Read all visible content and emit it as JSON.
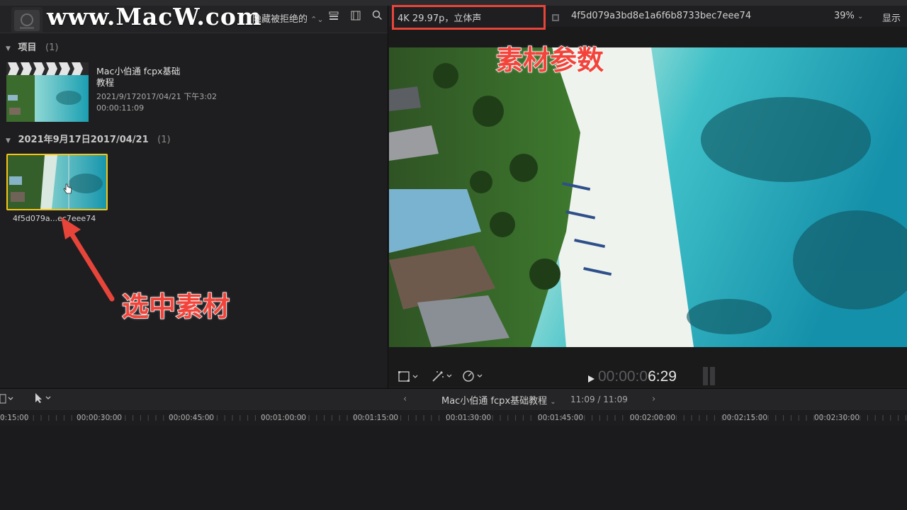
{
  "watermark": "www.MacW.com",
  "browser_bar": {
    "filter_label": "隐藏被拒绝的",
    "clip_info": "4K 29.97p，立体声",
    "clip_name": "4f5d079a3bd8e1a6f6b8733bec7eee74",
    "zoom": "39%",
    "display_label": "显示"
  },
  "library": {
    "projects_header": "项目",
    "projects_count": "(1)",
    "project": {
      "title_line1": "Mac小伯通 fcpx基础",
      "title_line2": "教程",
      "date": "2021/9/172017/04/21 下午3:02",
      "duration": "00:00:11:09"
    },
    "event_header": "2021年9月17日2017/04/21",
    "event_count": "(1)",
    "clip_label": "4f5d079a...ec7eee74"
  },
  "viewer": {
    "timecode_dim": "00:00:0",
    "timecode_bright": "6:29"
  },
  "timeline": {
    "project_name": "Mac小伯通 fcpx基础教程",
    "position": "11:09 / 11:09",
    "ruler_labels": [
      "0:15:00",
      "00:00:30:00",
      "00:00:45:00",
      "00:01:00:00",
      "00:01:15:00",
      "00:01:30:00",
      "00:01:45:00",
      "00:02:00:00",
      "00:02:15:00",
      "00:02:30:00"
    ]
  },
  "annotations": {
    "select_clip": "选中素材",
    "clip_params": "素材参数"
  },
  "colors": {
    "accent_red": "#f2443a",
    "selection_yellow": "#f5c518",
    "panel_bg": "#1e1e20"
  },
  "icons": [
    "app-logo-icon",
    "sort-chevron-icon",
    "list-view-icon",
    "filmstrip-icon",
    "search-icon",
    "film-icon",
    "transform-icon",
    "magic-wand-icon",
    "speed-icon",
    "play-icon",
    "arrow-tool-icon",
    "layout-icon",
    "back-icon",
    "forward-icon",
    "pointer-hand-icon"
  ]
}
